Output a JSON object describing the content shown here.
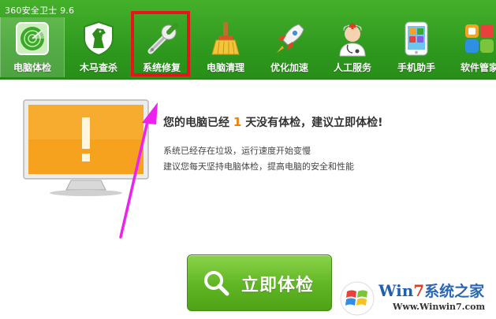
{
  "app": {
    "title": "360安全卫士 9.6"
  },
  "toolbar": {
    "items": [
      {
        "label": "电脑体检",
        "icon": "radar-icon"
      },
      {
        "label": "木马查杀",
        "icon": "horse-shield-icon"
      },
      {
        "label": "系统修复",
        "icon": "wrench-icon"
      },
      {
        "label": "电脑清理",
        "icon": "broom-icon"
      },
      {
        "label": "优化加速",
        "icon": "rocket-icon"
      },
      {
        "label": "人工服务",
        "icon": "doctor-icon"
      },
      {
        "label": "手机助手",
        "icon": "phone-icon"
      },
      {
        "label": "软件管家",
        "icon": "apps-icon"
      }
    ],
    "active_index": 0,
    "highlighted_index": 2
  },
  "main": {
    "status_prefix": "您的电脑已经",
    "days": "1",
    "status_suffix": "天没有体检，建议立即体检!",
    "line1": "系统已经存在垃圾，运行速度开始变慢",
    "line2": "建议您每天坚持电脑体检，提高电脑的安全和性能",
    "scan_button": "立即体检"
  },
  "watermark": {
    "brand_win": "Win",
    "brand_seven": "7",
    "brand_rest": "系统之家",
    "url": "Www.Winwin7.com"
  },
  "colors": {
    "header_green": "#2f9a1f",
    "highlight_red": "#e8141a",
    "arrow_magenta": "#ee22ee",
    "button_green": "#5fb523",
    "days_orange": "#f08000"
  }
}
